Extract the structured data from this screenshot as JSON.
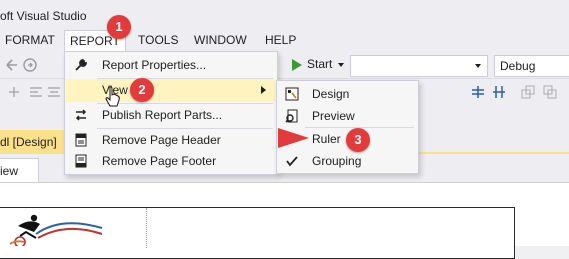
{
  "window": {
    "title": "oft Visual Studio"
  },
  "menubar": {
    "items": [
      {
        "key": "format",
        "label": "FORMAT"
      },
      {
        "key": "report",
        "label": "REPORT"
      },
      {
        "key": "tools",
        "label": "TOOLS"
      },
      {
        "key": "window",
        "label": "WINDOW"
      },
      {
        "key": "help",
        "label": "HELP"
      }
    ]
  },
  "toolbar": {
    "start_label": "Start",
    "config_value": "Debug"
  },
  "document": {
    "tab_label": "dl [Design]",
    "view_tab_label": "iew"
  },
  "report_menu": {
    "items": [
      {
        "label": "Report Properties...",
        "icon": "wrench-icon"
      },
      {
        "label": "View",
        "icon": "none",
        "has_submenu": true
      },
      {
        "label": "Publish Report Parts...",
        "icon": "publish-arrows-icon"
      },
      {
        "label": "Remove Page Header",
        "icon": "page-header-icon"
      },
      {
        "label": "Remove Page Footer",
        "icon": "page-footer-icon"
      }
    ]
  },
  "view_submenu": {
    "items": [
      {
        "label": "Design",
        "icon": "design-icon"
      },
      {
        "label": "Preview",
        "icon": "preview-icon"
      },
      {
        "label": "Ruler",
        "icon": "none",
        "checked": false
      },
      {
        "label": "Grouping",
        "icon": "checkmark-icon",
        "checked": true
      }
    ]
  },
  "callouts": {
    "one": "1",
    "two": "2",
    "three": "3"
  },
  "colors": {
    "callout_red": "#e23b3b",
    "highlight": "#fdf4bf",
    "design_tab": "#fbe18a",
    "play_green": "#3a9a3a"
  }
}
